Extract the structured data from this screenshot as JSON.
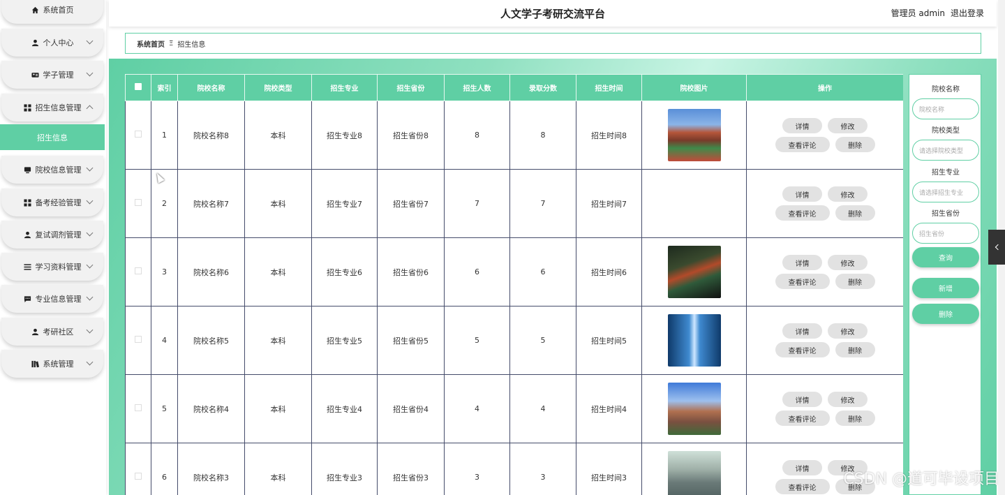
{
  "header": {
    "title": "人文学子考研交流平台",
    "user_label": "管理员 admin",
    "logout": "退出登录"
  },
  "breadcrumb": {
    "home": "系统首页",
    "separator": "Ξ",
    "current": "招生信息"
  },
  "sidebar": {
    "items": [
      {
        "label": "系统首页",
        "icon": "home-icon"
      },
      {
        "label": "个人中心",
        "icon": "user-icon"
      },
      {
        "label": "学子管理",
        "icon": "id-card-icon"
      },
      {
        "label": "招生信息管理",
        "icon": "grid-icon"
      },
      {
        "label": "院校信息管理",
        "icon": "monitor-icon"
      },
      {
        "label": "备考经验管理",
        "icon": "grid-icon"
      },
      {
        "label": "复试调剂管理",
        "icon": "user-icon"
      },
      {
        "label": "学习资料管理",
        "icon": "list-icon"
      },
      {
        "label": "专业信息管理",
        "icon": "chat-icon"
      },
      {
        "label": "考研社区",
        "icon": "user-icon"
      },
      {
        "label": "系统管理",
        "icon": "book-icon"
      }
    ],
    "active_sub": "招生信息"
  },
  "table": {
    "headers": [
      "索引",
      "院校名称",
      "院校类型",
      "招生专业",
      "招生省份",
      "招生人数",
      "录取分数",
      "招生时间",
      "院校图片",
      "操作"
    ],
    "rows": [
      {
        "index": "1",
        "school": "院校名称8",
        "type": "本科",
        "major": "招生专业8",
        "province": "招生省份8",
        "count": "8",
        "score": "8",
        "time": "招生时间8",
        "image": "campus-buildings-track"
      },
      {
        "index": "2",
        "school": "院校名称7",
        "type": "本科",
        "major": "招生专业7",
        "province": "招生省份7",
        "count": "7",
        "score": "7",
        "time": "招生时间7",
        "image": ""
      },
      {
        "index": "3",
        "school": "院校名称6",
        "type": "本科",
        "major": "招生专业6",
        "province": "招生省份6",
        "count": "6",
        "score": "6",
        "time": "招生时间6",
        "image": "campus-night-aerial"
      },
      {
        "index": "4",
        "school": "院校名称5",
        "type": "本科",
        "major": "招生专业5",
        "province": "招生省份5",
        "count": "5",
        "score": "5",
        "time": "招生时间5",
        "image": "glass-hall-blue"
      },
      {
        "index": "5",
        "school": "院校名称4",
        "type": "本科",
        "major": "招生专业4",
        "province": "招生省份4",
        "count": "4",
        "score": "4",
        "time": "招生时间4",
        "image": "campus-dorm-blue-sky"
      },
      {
        "index": "6",
        "school": "院校名称3",
        "type": "本科",
        "major": "招生专业3",
        "province": "招生省份3",
        "count": "3",
        "score": "3",
        "time": "招生时间3",
        "image": "campus-aerial-gray"
      }
    ],
    "actions": {
      "detail": "详情",
      "edit": "修改",
      "comments": "查看评论",
      "delete": "删除"
    }
  },
  "search": {
    "school_label": "院校名称",
    "school_placeholder": "院校名称",
    "type_label": "院校类型",
    "type_placeholder": "请选择院校类型",
    "major_label": "招生专业",
    "major_placeholder": "请选择招生专业",
    "province_label": "招生省份",
    "province_placeholder": "招生省份",
    "query": "查询",
    "add": "新增",
    "delete": "删除"
  },
  "colors": {
    "accent": "#5fcfa4",
    "grid_line": "#444b6a"
  },
  "watermark": "CSDN @道可毕设项目"
}
